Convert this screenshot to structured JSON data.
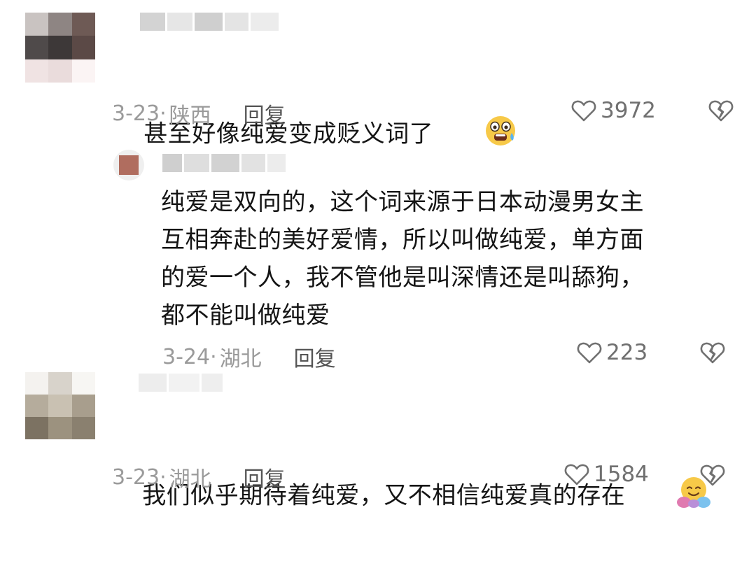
{
  "comments": [
    {
      "text": "甚至好像纯爱变成贬义词了",
      "emoji": "face-fearful-sweat",
      "date": "3-23·",
      "location": "陕西",
      "reply_label": "回复",
      "likes": "3972"
    },
    {
      "text": "纯爱是双向的，这个词来源于日本动漫男女主\n互相奔赴的美好爱情，所以叫做纯爱，单方面\n的爱一个人，我不管他是叫深情还是叫舔狗，\n都不能叫做纯爱",
      "date": "3-24·",
      "location": "湖北",
      "reply_label": "回复",
      "likes": "223"
    },
    {
      "text": "我们似乎期待着纯爱，又不相信纯爱真的存在",
      "emoji": "face-hugging",
      "date": "3-23·",
      "location": "湖北",
      "reply_label": "回复",
      "likes": "1584"
    }
  ],
  "icons": {
    "like": "heart-outline-icon",
    "dislike": "broken-heart-icon"
  },
  "colors": {
    "text": "#151515",
    "meta": "#9a9a9a",
    "reply": "#555555",
    "icon": "#707070"
  }
}
